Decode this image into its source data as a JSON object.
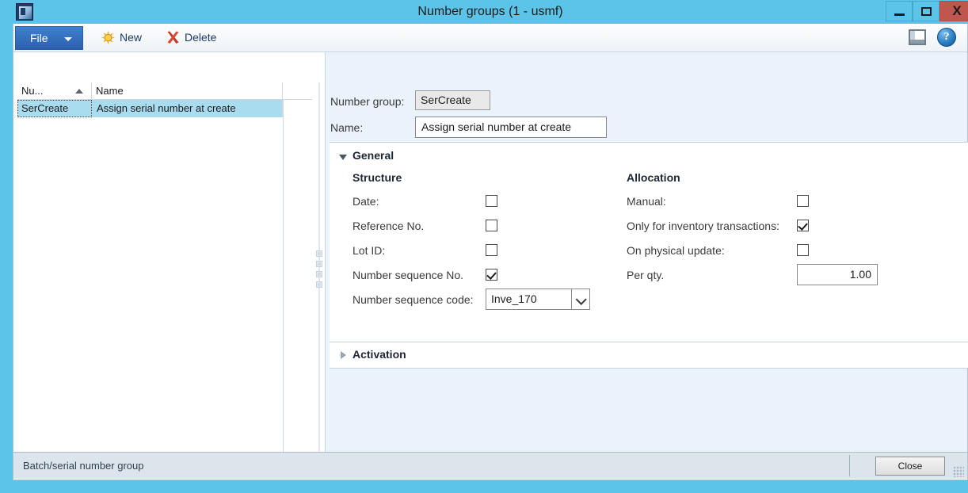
{
  "window": {
    "title": "Number groups (1 - usmf)",
    "app_icon": "app-window-icon",
    "minimize_label": "–",
    "maximize_label": "❐",
    "close_label": "X"
  },
  "toolbar": {
    "file_label": "File",
    "new_label": "New",
    "delete_label": "Delete",
    "layout_icon": "panel-layout-icon",
    "help_icon": "help-question-icon",
    "help_label": "?"
  },
  "grid": {
    "columns": [
      "Nu...",
      "Name"
    ],
    "sort_indicator": "ascending",
    "rows": [
      {
        "number_group": "SerCreate",
        "name": "Assign serial number at create",
        "selected": true
      }
    ]
  },
  "detail": {
    "number_group_label": "Number group:",
    "number_group_value": "SerCreate",
    "name_label": "Name:",
    "name_value": "Assign serial number at create",
    "groups": {
      "general": {
        "title": "General",
        "expanded": true,
        "structure": {
          "heading": "Structure",
          "fields": [
            {
              "label": "Date:",
              "checked": false
            },
            {
              "label": "Reference No.",
              "checked": false
            },
            {
              "label": "Lot ID:",
              "checked": false
            },
            {
              "label": "Number sequence No.",
              "checked": true
            }
          ],
          "number_sequence_code_label": "Number sequence code:",
          "number_sequence_code_value": "Inve_170"
        },
        "allocation": {
          "heading": "Allocation",
          "fields": [
            {
              "label": "Manual:",
              "checked": false
            },
            {
              "label": "Only for inventory transactions:",
              "checked": true
            },
            {
              "label": "On physical update:",
              "checked": false
            }
          ],
          "per_qty_label": "Per qty.",
          "per_qty_value": "1.00"
        }
      },
      "activation": {
        "title": "Activation",
        "expanded": false
      }
    }
  },
  "status": {
    "text": "Batch/serial number group",
    "close_label": "Close"
  },
  "colors": {
    "window_chrome": "#5bc4e8",
    "close_button": "#c0564d",
    "file_button": "#2b61ae",
    "detail_background": "#eaf3fb",
    "selection": "#aadcf0",
    "status_background": "#dde5ec"
  }
}
